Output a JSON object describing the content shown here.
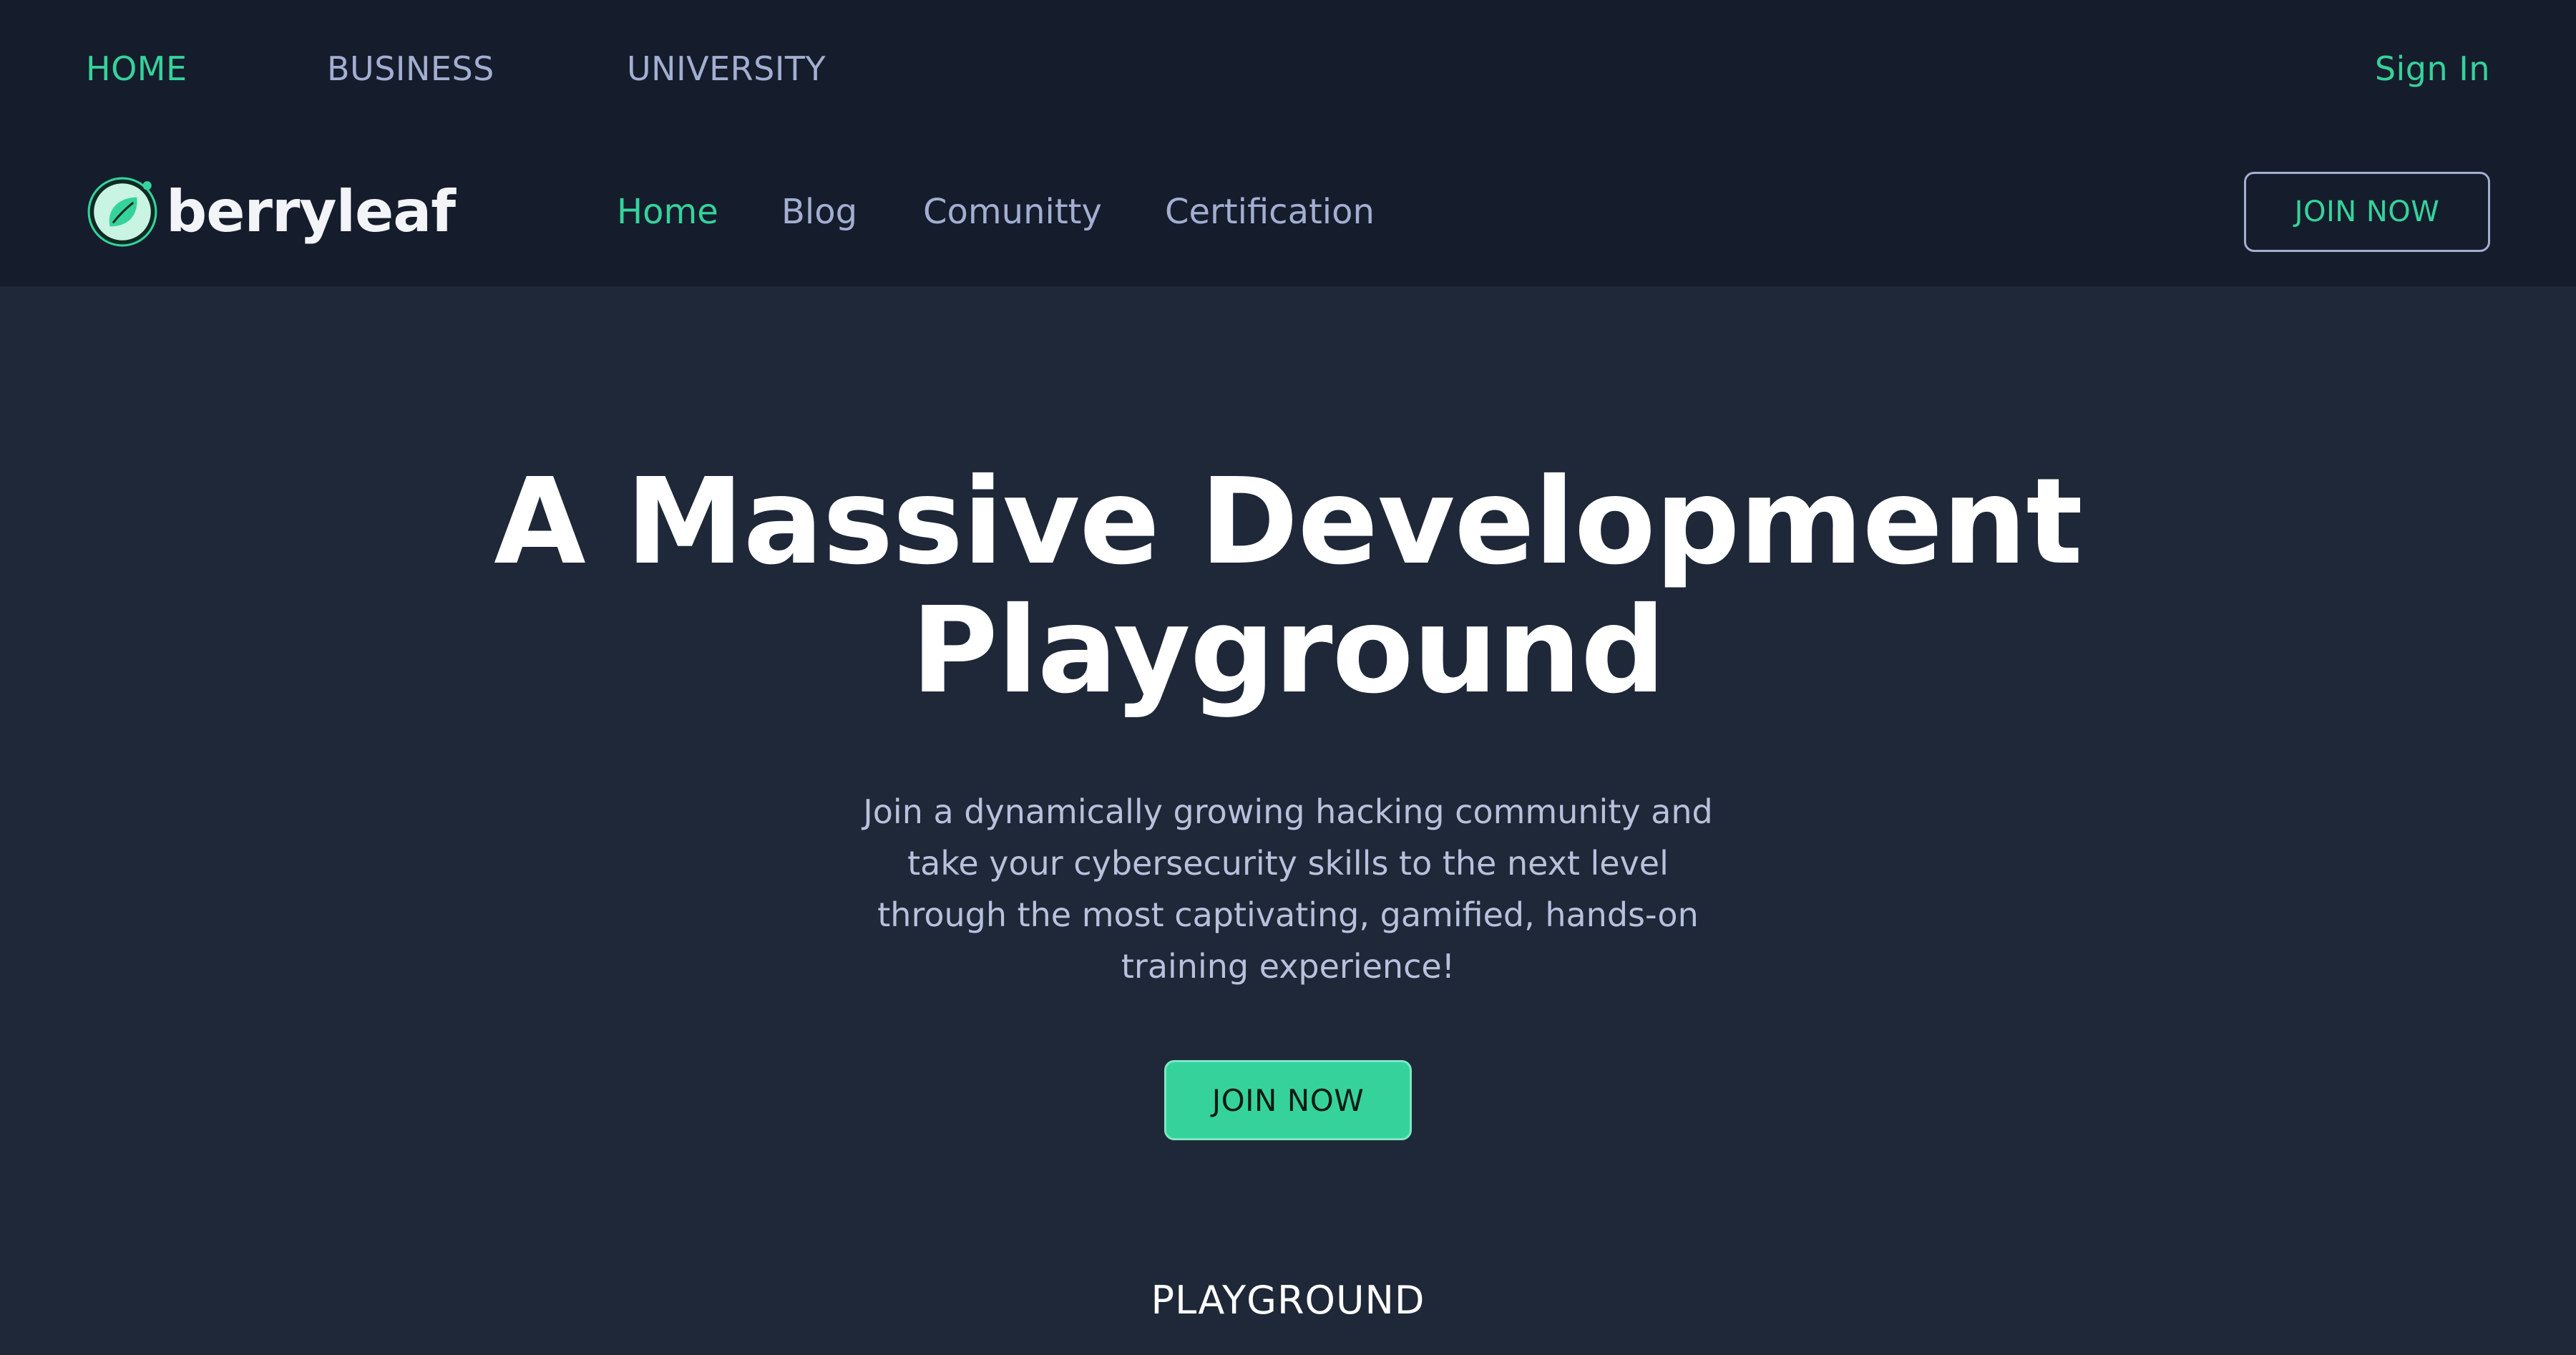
{
  "topbar": {
    "home": "HOME",
    "business": "BUSINESS",
    "university": "UNIVERSITY",
    "sign_in": "Sign In"
  },
  "brand": {
    "name": "berryleaf",
    "logo_icon": "leaf-circle-icon",
    "accent_color": "#35d39b"
  },
  "nav": {
    "items": [
      "Home",
      "Blog",
      "Comunitty",
      "Certification"
    ],
    "active": "Home",
    "join_label": "JOIN NOW"
  },
  "hero": {
    "title_line1": "A Massive Development",
    "title_line2": "Playground",
    "subtitle": "Join a dynamically growing hacking community and take your cybersecurity skills to the next level through the most captivating, gamified, hands-on training experience!",
    "cta_label": "JOIN NOW"
  },
  "section": {
    "label": "PLAYGROUND"
  },
  "colors": {
    "header_bg": "#151d2c",
    "page_bg": "#1f2838",
    "accent": "#35d39b",
    "muted_text": "#a3aed2"
  }
}
